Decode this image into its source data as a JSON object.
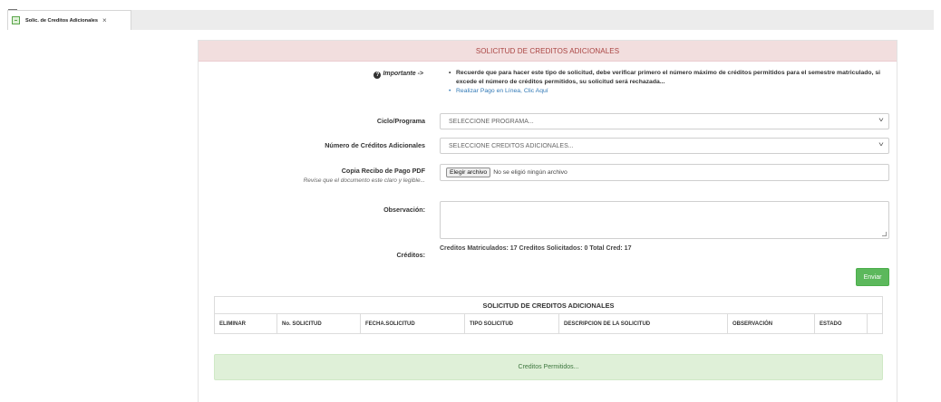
{
  "tabs": [
    {
      "label": "Solic. de Creditos Adicionales",
      "close": "×",
      "icon": "document-icon"
    }
  ],
  "panel": {
    "title": "SOLICITUD DE CREDITOS ADICIONALES",
    "header_color": "#f2dede"
  },
  "important": {
    "icon": "question-circle-icon",
    "label": "Importante ->",
    "notes": [
      "Recuerde que para hacer este tipo de solicitud, debe verificar primero el número máximo de créditos permitidos para el semestre matriculado, si excede el número de créditos permitidos, su solicitud será rechazada...",
      "Realizar Pago en Línea, Clic Aquí"
    ]
  },
  "form": {
    "program_label": "Ciclo/Programa",
    "program_value": "SELECCIONE PROGRAMA...",
    "credits_label": "Número de Créditos Adicionales",
    "credits_value": "SELECCIONE CREDITOS ADICIONALES...",
    "receipt_label": "Copia Recibo de Pago PDF",
    "receipt_hint": "Revise que el documento este claro y legible...",
    "file_button": "Elegir archivo",
    "file_status": "No se eligió ningún archivo",
    "observation_label": "Observación:",
    "observation_value": "",
    "credits_summary_label": "Créditos:",
    "credits_summary": "Creditos Matriculados: 17 Creditos Solicitados: 0 Total Cred: 17",
    "submit_label": "Enviar",
    "submit_color": "#5cb85c"
  },
  "table": {
    "title": "SOLICITUD DE CREDITOS ADICIONALES",
    "columns": [
      "ELIMINAR",
      "No. SOLICITUD",
      "FECHA.SOLICITUD",
      "TIPO SOLICITUD",
      "DESCRIPCION DE LA SOLICITUD",
      "OBSERVACIÓN",
      "ESTADO"
    ],
    "rows": []
  },
  "alert": {
    "text": "Creditos Permitidos...",
    "color": "#dff0d8"
  }
}
